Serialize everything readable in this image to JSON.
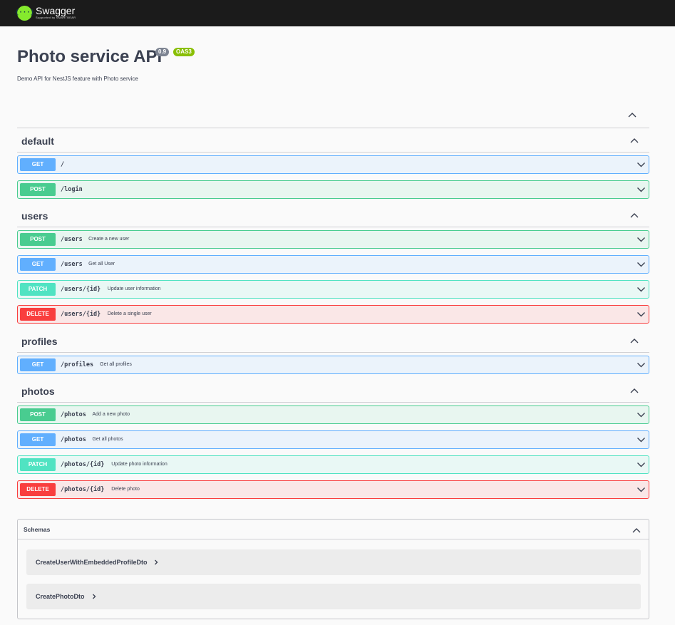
{
  "topbar": {
    "logo_mark": "{···}",
    "logo_name": "Swagger",
    "logo_sub": "Supported by SMARTBEAR"
  },
  "info": {
    "title": "Photo service API",
    "version": "0.9",
    "oas": "OAS3",
    "description": "Demo API for NestJS feature with Photo service"
  },
  "icons": {
    "expand": "chevron-down-icon",
    "collapse": "chevron-up-icon",
    "model_expand": "chevron-right-icon"
  },
  "colors": {
    "get": "#61affe",
    "post": "#49cc90",
    "patch": "#50e3c2",
    "delete": "#f93e3e",
    "topbar": "#1b1b1b",
    "logo": "#85ea2d"
  },
  "tags": [
    {
      "name": "default",
      "operations": [
        {
          "method": "GET",
          "path": "/",
          "summary": ""
        },
        {
          "method": "POST",
          "path": "/login",
          "summary": ""
        }
      ]
    },
    {
      "name": "users",
      "operations": [
        {
          "method": "POST",
          "path": "/users",
          "summary": "Create a new user"
        },
        {
          "method": "GET",
          "path": "/users",
          "summary": "Get all User"
        },
        {
          "method": "PATCH",
          "path": "/users/{id}",
          "summary": "Update user information"
        },
        {
          "method": "DELETE",
          "path": "/users/{id}",
          "summary": "Delete a single user"
        }
      ]
    },
    {
      "name": "profiles",
      "operations": [
        {
          "method": "GET",
          "path": "/profiles",
          "summary": "Get all profiles"
        }
      ]
    },
    {
      "name": "photos",
      "operations": [
        {
          "method": "POST",
          "path": "/photos",
          "summary": "Add a new photo"
        },
        {
          "method": "GET",
          "path": "/photos",
          "summary": "Get all photos"
        },
        {
          "method": "PATCH",
          "path": "/photos/{id}",
          "summary": "Update photo information"
        },
        {
          "method": "DELETE",
          "path": "/photos/{id}",
          "summary": "Delete photo"
        }
      ]
    }
  ],
  "schemas": {
    "title": "Schemas",
    "models": [
      "CreateUserWithEmbeddedProfileDto",
      "CreatePhotoDto"
    ]
  }
}
